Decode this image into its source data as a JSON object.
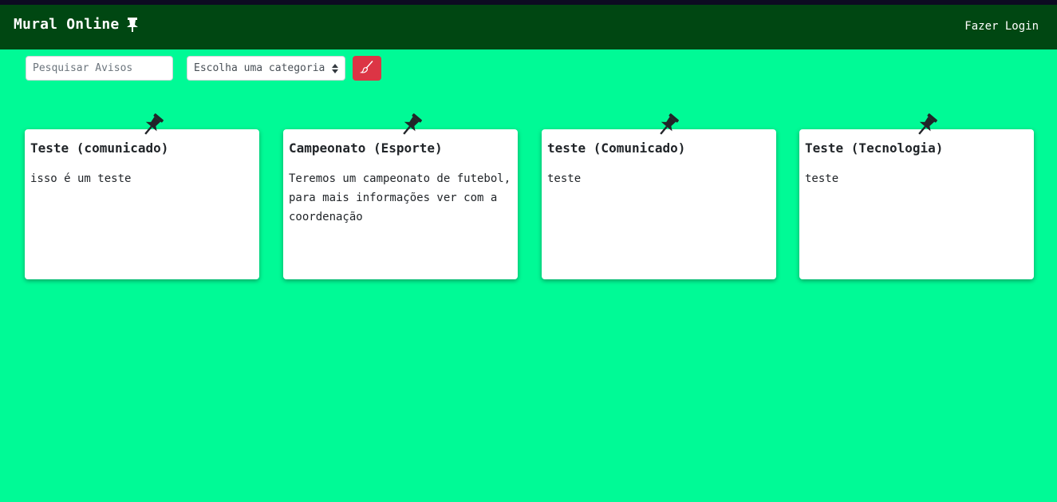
{
  "navbar": {
    "brand": "Mural Online",
    "login_label": "Fazer Login"
  },
  "filters": {
    "search_placeholder": "Pesquisar Avisos",
    "category_selected": "Escolha uma categoria",
    "clear_icon": "brush-icon"
  },
  "colors": {
    "background": "#00fa96",
    "navbar": "#004712",
    "danger": "#dc3545"
  },
  "notices": [
    {
      "title": "Teste (comunicado)",
      "body": "isso é um teste"
    },
    {
      "title": "Campeonato (Esporte)",
      "body": "Teremos um campeonato de futebol, para mais informações ver com a coordenação"
    },
    {
      "title": "teste (Comunicado)",
      "body": "teste"
    },
    {
      "title": "Teste (Tecnologia)",
      "body": "teste"
    }
  ]
}
